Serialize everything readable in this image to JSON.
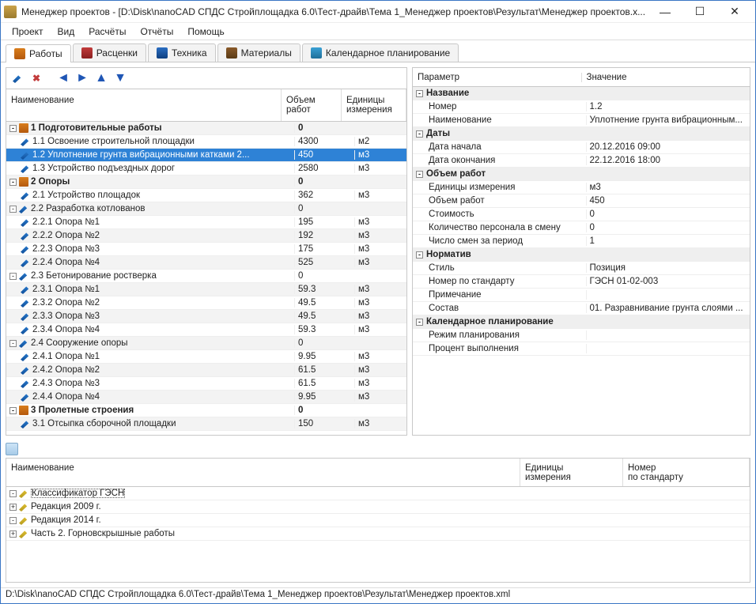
{
  "window": {
    "title": "Менеджер проектов - [D:\\Disk\\nanoCAD СПДС Стройплощадка 6.0\\Тест-драйв\\Тема 1_Менеджер проектов\\Результат\\Менеджер проектов.x..."
  },
  "menu": {
    "items": [
      "Проект",
      "Вид",
      "Расчёты",
      "Отчёты",
      "Помощь"
    ]
  },
  "tabs": {
    "items": [
      {
        "label": "Работы",
        "active": true
      },
      {
        "label": "Расценки"
      },
      {
        "label": "Техника"
      },
      {
        "label": "Материалы"
      },
      {
        "label": "Календарное планирование"
      }
    ]
  },
  "left": {
    "headers": {
      "name": "Наименование",
      "vol": "Объем\nработ",
      "unit": "Единицы\nизмерения"
    },
    "rows": [
      {
        "lvl": 0,
        "exp": "-",
        "ic": "hammer",
        "bold": true,
        "alt": true,
        "name": "1 Подготовительные работы",
        "vol": "0",
        "unit": ""
      },
      {
        "lvl": 1,
        "ic": "pen",
        "name": "1.1 Освоение строительной площадки",
        "vol": "4300",
        "unit": "м2"
      },
      {
        "lvl": 1,
        "ic": "pen",
        "sel": true,
        "name": "1.2 Уплотнение грунта вибрационными катками 2...",
        "vol": "450",
        "unit": "м3"
      },
      {
        "lvl": 1,
        "ic": "pen",
        "name": "1.3 Устройство подъездных дорог",
        "vol": "2580",
        "unit": "м3"
      },
      {
        "lvl": 0,
        "exp": "-",
        "ic": "hammer",
        "bold": true,
        "alt": true,
        "name": "2 Опоры",
        "vol": "0",
        "unit": ""
      },
      {
        "lvl": 1,
        "ic": "pen",
        "name": "2.1 Устройство площадок",
        "vol": "362",
        "unit": "м3"
      },
      {
        "lvl": 1,
        "exp": "-",
        "ic": "pen",
        "alt": true,
        "name": "2.2 Разработка котлованов",
        "vol": "0",
        "unit": ""
      },
      {
        "lvl": 2,
        "ic": "pen",
        "name": "2.2.1 Опора №1",
        "vol": "195",
        "unit": "м3"
      },
      {
        "lvl": 2,
        "ic": "pen",
        "alt": true,
        "name": "2.2.2 Опора №2",
        "vol": "192",
        "unit": "м3"
      },
      {
        "lvl": 2,
        "ic": "pen",
        "name": "2.2.3 Опора №3",
        "vol": "175",
        "unit": "м3"
      },
      {
        "lvl": 2,
        "ic": "pen",
        "alt": true,
        "name": "2.2.4 Опора №4",
        "vol": "525",
        "unit": "м3"
      },
      {
        "lvl": 1,
        "exp": "-",
        "ic": "pen",
        "name": "2.3 Бетонирование ростверка",
        "vol": "0",
        "unit": ""
      },
      {
        "lvl": 2,
        "ic": "pen",
        "alt": true,
        "name": "2.3.1 Опора №1",
        "vol": "59.3",
        "unit": "м3"
      },
      {
        "lvl": 2,
        "ic": "pen",
        "name": "2.3.2 Опора №2",
        "vol": "49.5",
        "unit": "м3"
      },
      {
        "lvl": 2,
        "ic": "pen",
        "alt": true,
        "name": "2.3.3 Опора №3",
        "vol": "49.5",
        "unit": "м3"
      },
      {
        "lvl": 2,
        "ic": "pen",
        "name": "2.3.4 Опора №4",
        "vol": "59.3",
        "unit": "м3"
      },
      {
        "lvl": 1,
        "exp": "-",
        "ic": "pen",
        "alt": true,
        "name": "2.4 Сооружение опоры",
        "vol": "0",
        "unit": ""
      },
      {
        "lvl": 2,
        "ic": "pen",
        "name": "2.4.1 Опора №1",
        "vol": "9.95",
        "unit": "м3"
      },
      {
        "lvl": 2,
        "ic": "pen",
        "alt": true,
        "name": "2.4.2 Опора №2",
        "vol": "61.5",
        "unit": "м3"
      },
      {
        "lvl": 2,
        "ic": "pen",
        "name": "2.4.3 Опора №3",
        "vol": "61.5",
        "unit": "м3"
      },
      {
        "lvl": 2,
        "ic": "pen",
        "alt": true,
        "name": "2.4.4 Опора №4",
        "vol": "9.95",
        "unit": "м3"
      },
      {
        "lvl": 0,
        "exp": "-",
        "ic": "hammer",
        "bold": true,
        "name": "3 Пролетные строения",
        "vol": "0",
        "unit": ""
      },
      {
        "lvl": 1,
        "ic": "pen",
        "alt": true,
        "name": "3.1 Отсыпка сборочной площадки",
        "vol": "150",
        "unit": "м3"
      }
    ]
  },
  "props": {
    "headers": {
      "param": "Параметр",
      "value": "Значение"
    },
    "groups": [
      {
        "title": "Название",
        "rows": [
          {
            "k": "Номер",
            "v": "1.2"
          },
          {
            "k": "Наименование",
            "v": "Уплотнение грунта вибрационным..."
          }
        ]
      },
      {
        "title": "Даты",
        "rows": [
          {
            "k": "Дата начала",
            "v": "20.12.2016 09:00"
          },
          {
            "k": "Дата окончания",
            "v": "22.12.2016 18:00"
          }
        ]
      },
      {
        "title": "Объем работ",
        "rows": [
          {
            "k": "Единицы измерения",
            "v": "м3"
          },
          {
            "k": "Объем работ",
            "v": "450"
          },
          {
            "k": "Стоимость",
            "v": "0"
          },
          {
            "k": "Количество персонала в смену",
            "v": "0"
          },
          {
            "k": "Число смен за период",
            "v": "1"
          }
        ]
      },
      {
        "title": "Норматив",
        "rows": [
          {
            "k": "Стиль",
            "v": "Позиция"
          },
          {
            "k": "Номер по стандарту",
            "v": "ГЭСН 01-02-003"
          },
          {
            "k": "Примечание",
            "v": ""
          },
          {
            "k": "Состав",
            "v": "01. Разравнивание грунта слоями ..."
          }
        ]
      },
      {
        "title": "Календарное планирование",
        "rows": [
          {
            "k": "Режим планирования",
            "v": ""
          },
          {
            "k": "Процент выполнения",
            "v": ""
          }
        ]
      }
    ]
  },
  "classifier": {
    "headers": {
      "name": "Наименование",
      "unit": "Единицы\nизмерения",
      "num": "Номер\nпо стандарту"
    },
    "rows": [
      {
        "lvl": 0,
        "exp": "-",
        "ic": "yel",
        "name": "Классификатор ГЭСН",
        "sel": true
      },
      {
        "lvl": 1,
        "exp": "+",
        "ic": "yel",
        "name": "Редакция 2009 г."
      },
      {
        "lvl": 1,
        "exp": "-",
        "ic": "yel",
        "name": "Редакция 2014 г."
      },
      {
        "lvl": 2,
        "exp": "+",
        "ic": "yel",
        "name": "Часть 2. Горновскрышные работы"
      }
    ]
  },
  "status": {
    "text": "D:\\Disk\\nanoCAD СПДС Стройплощадка 6.0\\Тест-драйв\\Тема 1_Менеджер проектов\\Результат\\Менеджер проектов.xml"
  }
}
